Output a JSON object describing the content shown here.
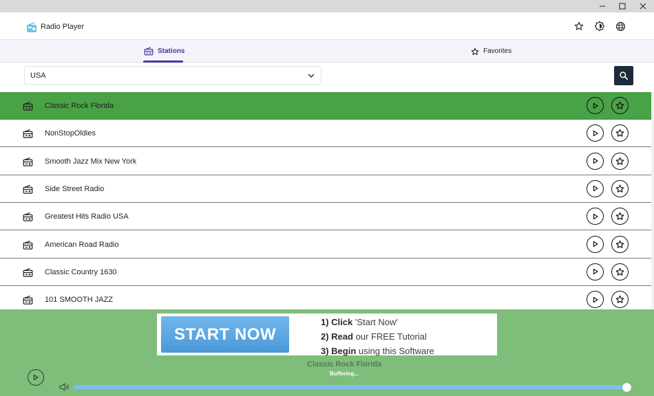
{
  "app": {
    "title": "Radio Player"
  },
  "tabs": [
    {
      "label": "Stations",
      "active": true
    },
    {
      "label": "Favorites",
      "active": false
    }
  ],
  "search": {
    "country": "USA"
  },
  "stations": [
    {
      "name": "Classic Rock Florida",
      "active": true
    },
    {
      "name": "NonStopOldies",
      "active": false
    },
    {
      "name": "Smooth Jazz Mix New York",
      "active": false
    },
    {
      "name": "Side Street Radio",
      "active": false
    },
    {
      "name": "Greatest Hits Radio USA",
      "active": false
    },
    {
      "name": "American Road Radio",
      "active": false
    },
    {
      "name": "Classic Country 1630",
      "active": false
    },
    {
      "name": "101 SMOOTH JAZZ",
      "active": false
    }
  ],
  "ad": {
    "button": "START NOW",
    "step1_bold": "1) Click",
    "step1_rest": " 'Start Now'",
    "step2_bold": "2) Read",
    "step2_rest": " our FREE Tutorial",
    "step3_bold": "3) Begin",
    "step3_rest": " using  this Software"
  },
  "player": {
    "title": "Classic Rock Florida",
    "status": "Buffering...",
    "volume": 1.0
  },
  "colors": {
    "active_row": "#4aa246",
    "footer": "#7fbd7a",
    "accent": "#3f3aa0",
    "search_button": "#1d2b3c"
  },
  "icons": {
    "app": "radio-icon",
    "header": [
      "star-icon",
      "brightness-icon",
      "globe-icon"
    ],
    "row_play": "play-icon",
    "row_favorite": "star-icon"
  }
}
